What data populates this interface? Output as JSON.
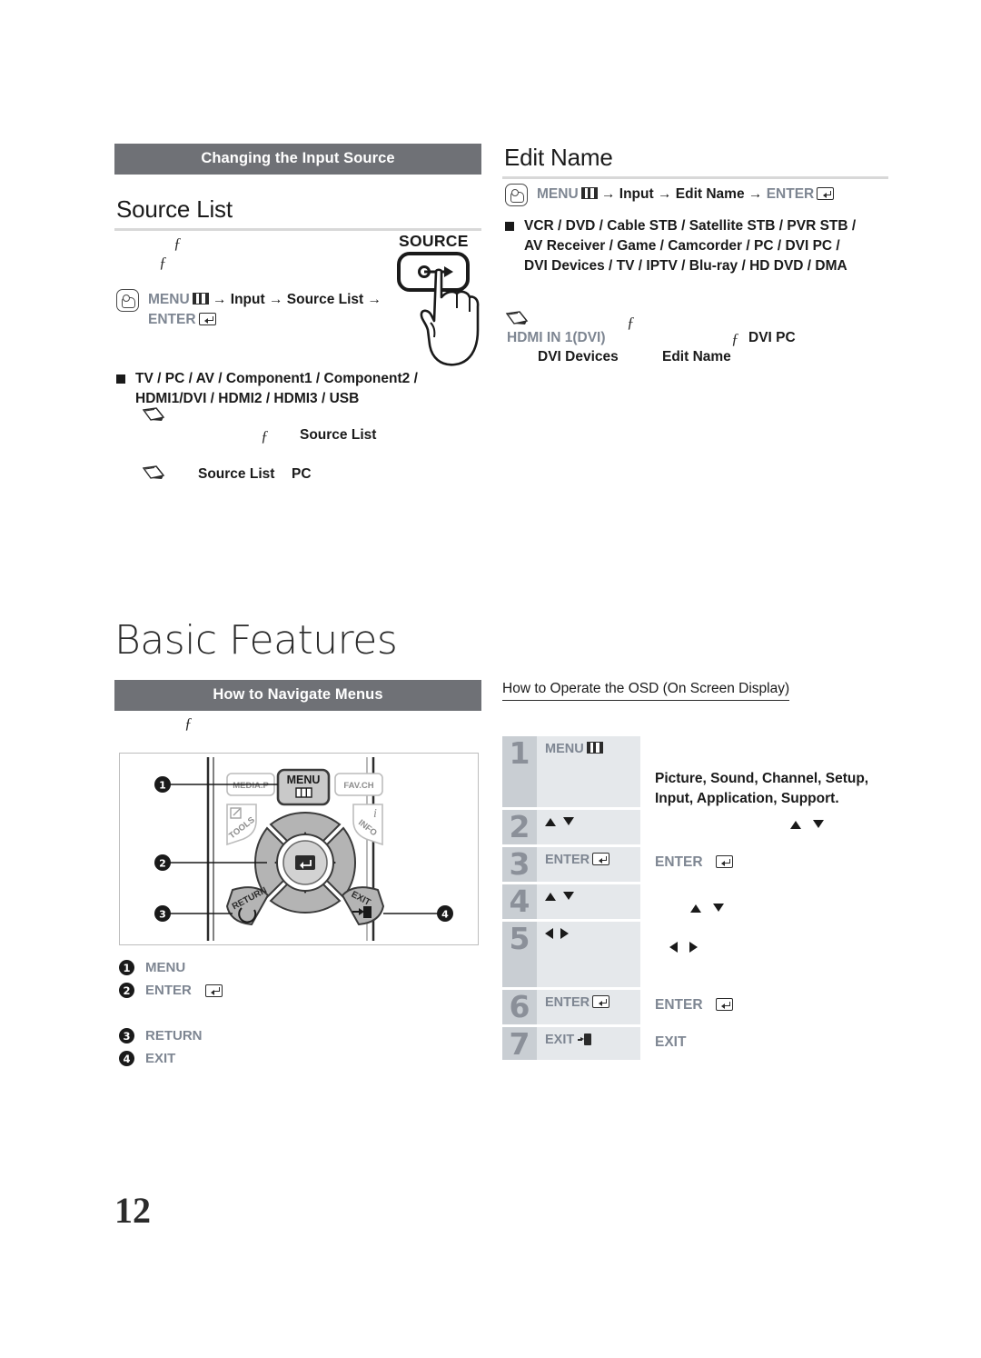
{
  "page": {
    "number": "12"
  },
  "left": {
    "section_bar": "Changing the Input Source",
    "heading": "Source List",
    "path": {
      "menu": "MENU",
      "arrow": "→",
      "input": "Input",
      "target": "Source List",
      "enter": "ENTER"
    },
    "sources_line1": "TV / PC / AV / Component1 / Component2 /",
    "sources_line2": "HDMI1/DVI / HDMI2 / HDMI3 / USB",
    "note1_term": "Source List",
    "note2_term1": "Source List",
    "note2_term2": "PC",
    "f_marks": [
      "ƒ",
      "ƒ",
      "ƒ"
    ],
    "source_button_label": "SOURCE"
  },
  "right": {
    "heading": "Edit Name",
    "path": {
      "menu": "MENU",
      "arrow": "→",
      "input": "Input",
      "target": "Edit Name",
      "enter": "ENTER"
    },
    "names_line1": "VCR / DVD / Cable STB / Satellite STB / PVR STB /",
    "names_line2": "AV Receiver / Game / Camcorder / PC / DVI PC /",
    "names_line3": "DVI Devices / TV / IPTV / Blu-ray / HD DVD / DMA",
    "note": {
      "hdmi_term": "HDMI IN 1(DVI)",
      "dvipc_term": "DVI PC",
      "dvidevices_term": "DVI Devices",
      "editname_term": "Edit Name",
      "f_marks": [
        "ƒ",
        "ƒ"
      ]
    }
  },
  "basic_features": {
    "title": "Basic Features",
    "section_bar": "How to Navigate Menus",
    "f_mark": "ƒ",
    "remote": {
      "buttons": {
        "media_p": "MEDIA.P",
        "menu": "MENU",
        "fav_ch": "FAV.CH",
        "tools": "TOOLS",
        "info": "INFO",
        "return": "RETURN",
        "exit": "EXIT"
      },
      "markers": [
        "1",
        "2",
        "3",
        "4"
      ]
    },
    "callouts": [
      {
        "num": "1",
        "label": "MENU",
        "glyph": "none"
      },
      {
        "num": "2",
        "label": "ENTER",
        "glyph": "enter"
      },
      {
        "num": "3",
        "label": "RETURN",
        "glyph": "none"
      },
      {
        "num": "4",
        "label": "EXIT",
        "glyph": "none"
      }
    ]
  },
  "osd": {
    "title": "How to Operate the OSD (On Screen Display)",
    "rows": [
      {
        "num": "1",
        "key": "MENU",
        "key_glyph": "menu",
        "desc": "Picture, Sound, Channel, Setup, Input, Application, Support.",
        "desc_glyph": "none"
      },
      {
        "num": "2",
        "key": "",
        "key_glyph": "updown",
        "desc": "",
        "desc_glyph": "updown"
      },
      {
        "num": "3",
        "key": "ENTER",
        "key_glyph": "enter",
        "desc": "ENTER",
        "desc_glyph": "enter"
      },
      {
        "num": "4",
        "key": "",
        "key_glyph": "updown",
        "desc": "",
        "desc_glyph": "updown"
      },
      {
        "num": "5",
        "key": "",
        "key_glyph": "leftright",
        "desc": "",
        "desc_glyph": "leftright"
      },
      {
        "num": "6",
        "key": "ENTER",
        "key_glyph": "enter",
        "desc": "ENTER",
        "desc_glyph": "enter"
      },
      {
        "num": "7",
        "key": "EXIT",
        "key_glyph": "exit",
        "desc": "EXIT",
        "desc_glyph": "none"
      }
    ]
  },
  "colors": {
    "bar_gray": "#6f7176",
    "key_gray": "#7e8692",
    "osd_num_bg": "#c9ced3",
    "osd_key_bg": "#e5e8eb"
  }
}
